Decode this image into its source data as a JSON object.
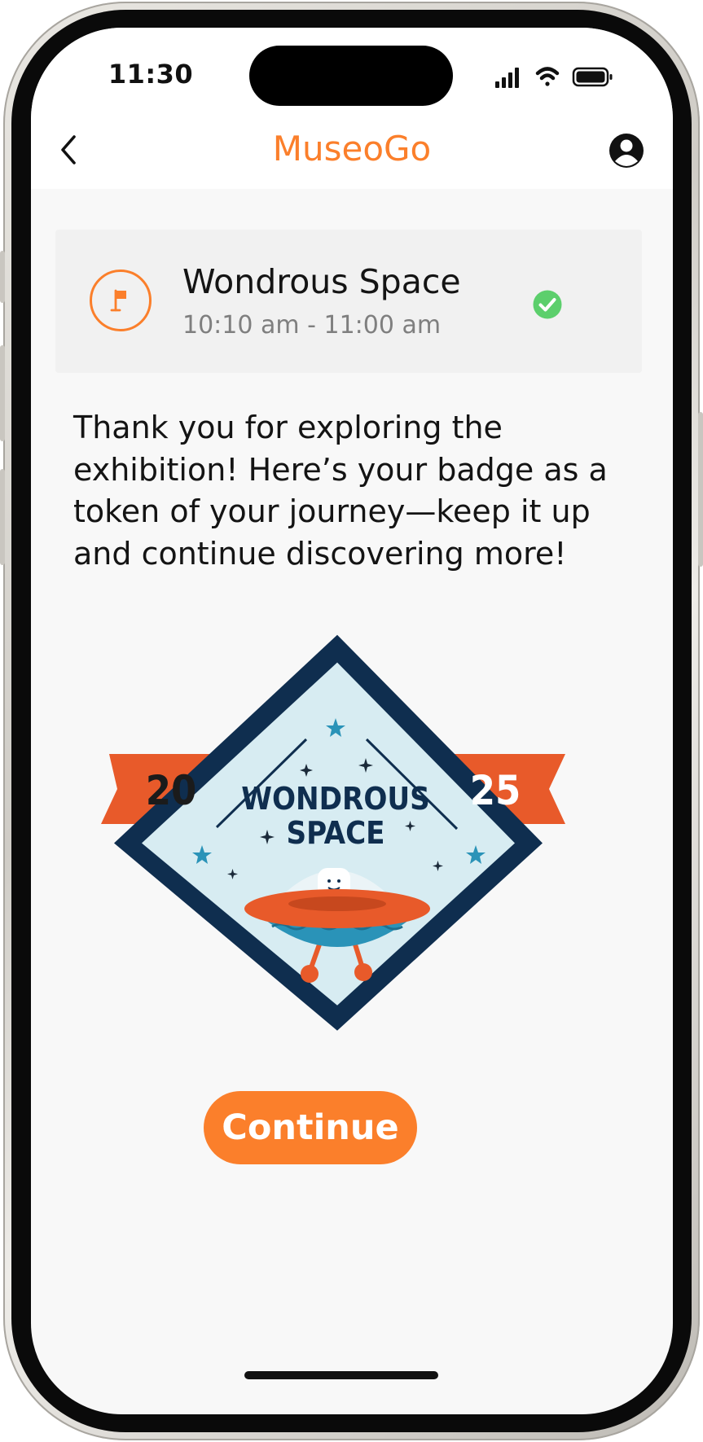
{
  "status_bar": {
    "time": "11:30",
    "icons": [
      "cellular-signal-icon",
      "wifi-icon",
      "battery-icon"
    ]
  },
  "nav": {
    "back_icon": "chevron-left-icon",
    "title": "MuseoGo",
    "profile_icon": "user-circle-icon"
  },
  "session": {
    "icon": "flag-icon",
    "title": "Wondrous Space",
    "time": "10:10 am - 11:00 am",
    "status_icon": "check-circle-icon",
    "status_color": "#5ccf6c"
  },
  "message": "Thank you for exploring the exhibition! Here’s your badge as a token of your journey—keep it up and continue discovering more!",
  "badge": {
    "year_left": "20",
    "year_right": "25",
    "title_line1": "WONDROUS",
    "title_line2": "SPACE"
  },
  "continue_label": "Continue",
  "colors": {
    "accent": "#fb7f2b",
    "badge_navy": "#0f2e4f",
    "badge_ribbon": "#e85a2a",
    "badge_sky": "#d7ecf2",
    "badge_teal": "#2a93b8"
  }
}
